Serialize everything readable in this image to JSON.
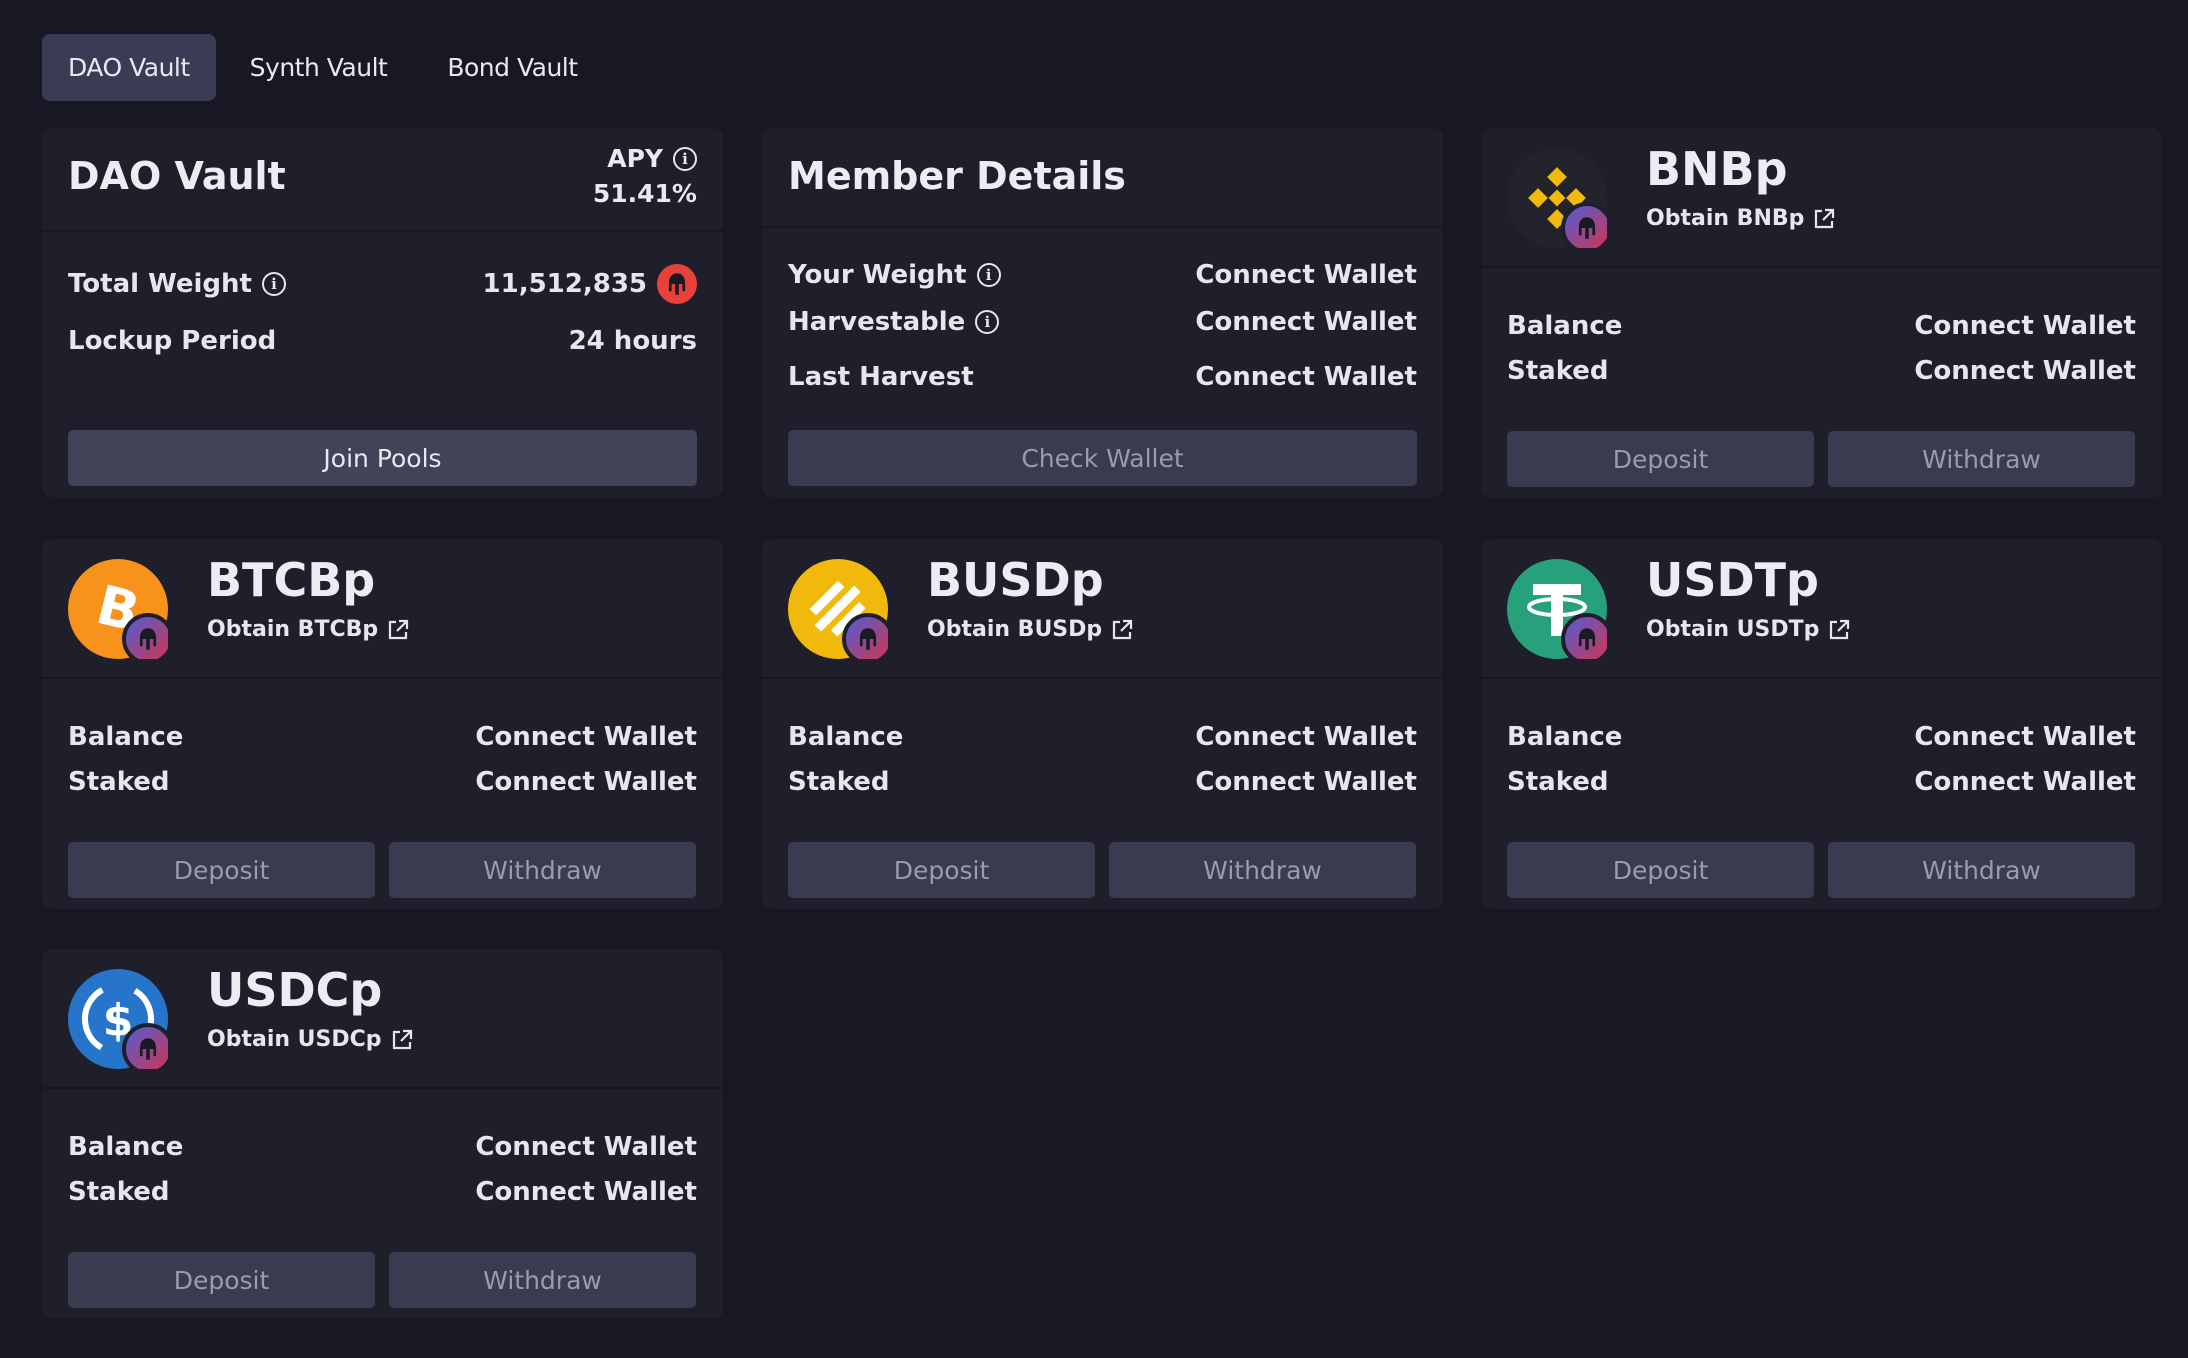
{
  "tabs": [
    "DAO Vault",
    "Synth Vault",
    "Bond Vault"
  ],
  "dao_vault": {
    "title": "DAO Vault",
    "apy_label": "APY",
    "apy_value": "51.41%",
    "total_weight_label": "Total Weight",
    "total_weight_value": "11,512,835",
    "lockup_label": "Lockup Period",
    "lockup_value": "24 hours",
    "join_button": "Join Pools"
  },
  "member": {
    "title": "Member Details",
    "weight_label": "Your Weight",
    "weight_value": "Connect Wallet",
    "harvestable_label": "Harvestable",
    "harvestable_value": "Connect Wallet",
    "last_harvest_label": "Last Harvest",
    "last_harvest_value": "Connect Wallet",
    "check_button": "Check Wallet"
  },
  "pools": [
    {
      "name": "BNBp",
      "link": "Obtain BNBp",
      "balance_label": "Balance",
      "balance_value": "Connect Wallet",
      "staked_label": "Staked",
      "staked_value": "Connect Wallet",
      "deposit": "Deposit",
      "withdraw": "Withdraw",
      "icon": "bnb-icon",
      "color": "#f0b90b"
    },
    {
      "name": "BTCBp",
      "link": "Obtain BTCBp",
      "balance_label": "Balance",
      "balance_value": "Connect Wallet",
      "staked_label": "Staked",
      "staked_value": "Connect Wallet",
      "deposit": "Deposit",
      "withdraw": "Withdraw",
      "icon": "btc-icon",
      "color": "#f7931a"
    },
    {
      "name": "BUSDp",
      "link": "Obtain BUSDp",
      "balance_label": "Balance",
      "balance_value": "Connect Wallet",
      "staked_label": "Staked",
      "staked_value": "Connect Wallet",
      "deposit": "Deposit",
      "withdraw": "Withdraw",
      "icon": "busd-icon",
      "color": "#f0b90b"
    },
    {
      "name": "USDTp",
      "link": "Obtain USDTp",
      "balance_label": "Balance",
      "balance_value": "Connect Wallet",
      "staked_label": "Staked",
      "staked_value": "Connect Wallet",
      "deposit": "Deposit",
      "withdraw": "Withdraw",
      "icon": "usdt-icon",
      "color": "#26a17b"
    },
    {
      "name": "USDCp",
      "link": "Obtain USDCp",
      "balance_label": "Balance",
      "balance_value": "Connect Wallet",
      "staked_label": "Staked",
      "staked_value": "Connect Wallet",
      "deposit": "Deposit",
      "withdraw": "Withdraw",
      "icon": "usdc-icon",
      "color": "#2775ca"
    }
  ]
}
